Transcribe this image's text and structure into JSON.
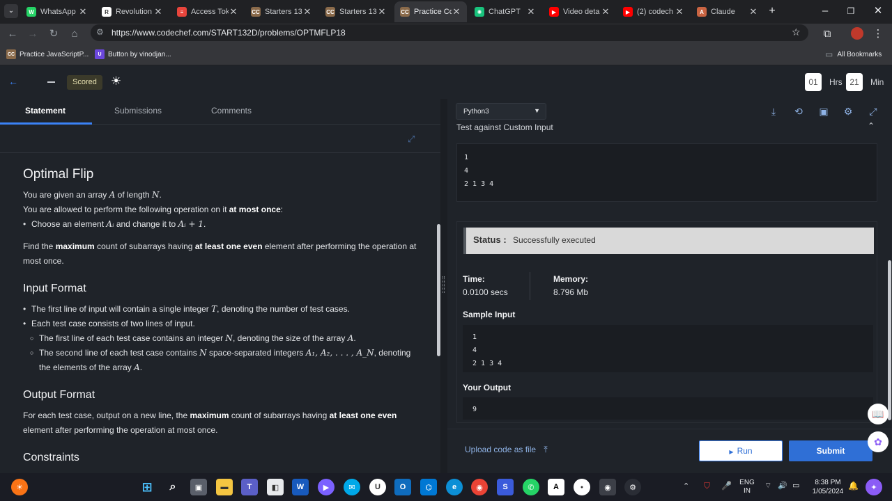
{
  "browser": {
    "tabs": [
      {
        "label": "WhatsApp",
        "icon": "whatsapp-icon",
        "color": "#25d366",
        "glyph": "W"
      },
      {
        "label": "Revolution",
        "icon": "revolution-icon",
        "color": "#ffffff",
        "glyph": "R"
      },
      {
        "label": "Access Tok",
        "icon": "access-token-icon",
        "color": "#e8453c",
        "glyph": "≡"
      },
      {
        "label": "Starters 13",
        "icon": "codechef-icon",
        "color": "#8a6a4a",
        "glyph": "CC"
      },
      {
        "label": "Starters 13",
        "icon": "codechef-icon",
        "color": "#8a6a4a",
        "glyph": "CC"
      },
      {
        "label": "Practice Co",
        "icon": "codechef-icon",
        "color": "#8a6a4a",
        "glyph": "CC"
      },
      {
        "label": "ChatGPT",
        "icon": "chatgpt-icon",
        "color": "#19c37d",
        "glyph": "✺"
      },
      {
        "label": "Video deta",
        "icon": "youtube-icon",
        "color": "#ff0000",
        "glyph": "▶"
      },
      {
        "label": "(2) codech",
        "icon": "youtube-icon",
        "color": "#ff0000",
        "glyph": "▶"
      },
      {
        "label": "Claude",
        "icon": "claude-icon",
        "color": "#c96442",
        "glyph": "A"
      }
    ],
    "active_tab_index": 5,
    "url": "https://www.codechef.com/START132D/problems/OPTMFLP18",
    "bookmarks": [
      {
        "label": "Practice JavaScriptP...",
        "icon": "codechef-icon",
        "glyph": "CC",
        "color": "#8a6a4a"
      },
      {
        "label": "Button by vinodjan...",
        "icon": "uiverse-icon",
        "glyph": "U",
        "color": "#6b47dc"
      }
    ],
    "all_bookmarks_label": "All Bookmarks"
  },
  "header": {
    "scored_label": "Scored",
    "timer": {
      "hours": "01",
      "hours_label": "Hrs",
      "minutes": "21",
      "minutes_label": "Min"
    }
  },
  "left": {
    "tabs": [
      "Statement",
      "Submissions",
      "Comments"
    ],
    "problem": {
      "title": "Optimal Flip",
      "intro1_a": "You are given an array ",
      "intro1_b": "A",
      "intro1_c": " of length ",
      "intro1_d": "N",
      "intro1_e": ".",
      "intro2_a": "You are allowed to perform the following operation on it ",
      "intro2_b": "at most once",
      "intro2_c": ":",
      "op_a": "Choose an element ",
      "op_b": "Aᵢ",
      "op_c": " and change it to ",
      "op_d": "Aᵢ + 1",
      "op_e": ".",
      "task_a": "Find the ",
      "task_b": "maximum",
      "task_c": " count of subarrays having ",
      "task_d": "at least one even",
      "task_e": " element after performing the operation at most once.",
      "input_heading": "Input Format",
      "in1_a": "The first line of input will contain a single integer ",
      "in1_b": "T",
      "in1_c": ", denoting the number of test cases.",
      "in2": "Each test case consists of two lines of input.",
      "in3_a": "The first line of each test case contains an integer ",
      "in3_b": "N",
      "in3_c": ", denoting the size of the array ",
      "in3_d": "A",
      "in3_e": ".",
      "in4_a": "The second line of each test case contains ",
      "in4_b": "N",
      "in4_c": " space-separated integers ",
      "in4_d": "A₁, A₂, . . . , A_N",
      "in4_e": ", denoting the elements of the array ",
      "in4_f": "A",
      "in4_g": ".",
      "output_heading": "Output Format",
      "out_a": "For each test case, output on a new line, the ",
      "out_b": "maximum",
      "out_c": " count of subarrays having ",
      "out_d": "at least one even",
      "out_e": " element after performing the operation at most once.",
      "constraints_heading": "Constraints"
    }
  },
  "right": {
    "language": "Python3",
    "custom_input_label": "Test against Custom Input",
    "custom_input": "1\n4\n2 1 3 4",
    "status_label": "Status :",
    "status_value": "Successfully executed",
    "time_label": "Time:",
    "time_value": "0.0100 secs",
    "memory_label": "Memory:",
    "memory_value": "8.796 Mb",
    "sample_input_label": "Sample Input",
    "sample_input": "1\n4\n2 1 3 4",
    "your_output_label": "Your Output",
    "your_output": "9",
    "upload_label": "Upload code as file",
    "run_label": "Run",
    "submit_label": "Submit"
  },
  "taskbar": {
    "lang": "ENG",
    "region": "IN",
    "time": "8:38 PM",
    "date": "1/05/2024"
  }
}
